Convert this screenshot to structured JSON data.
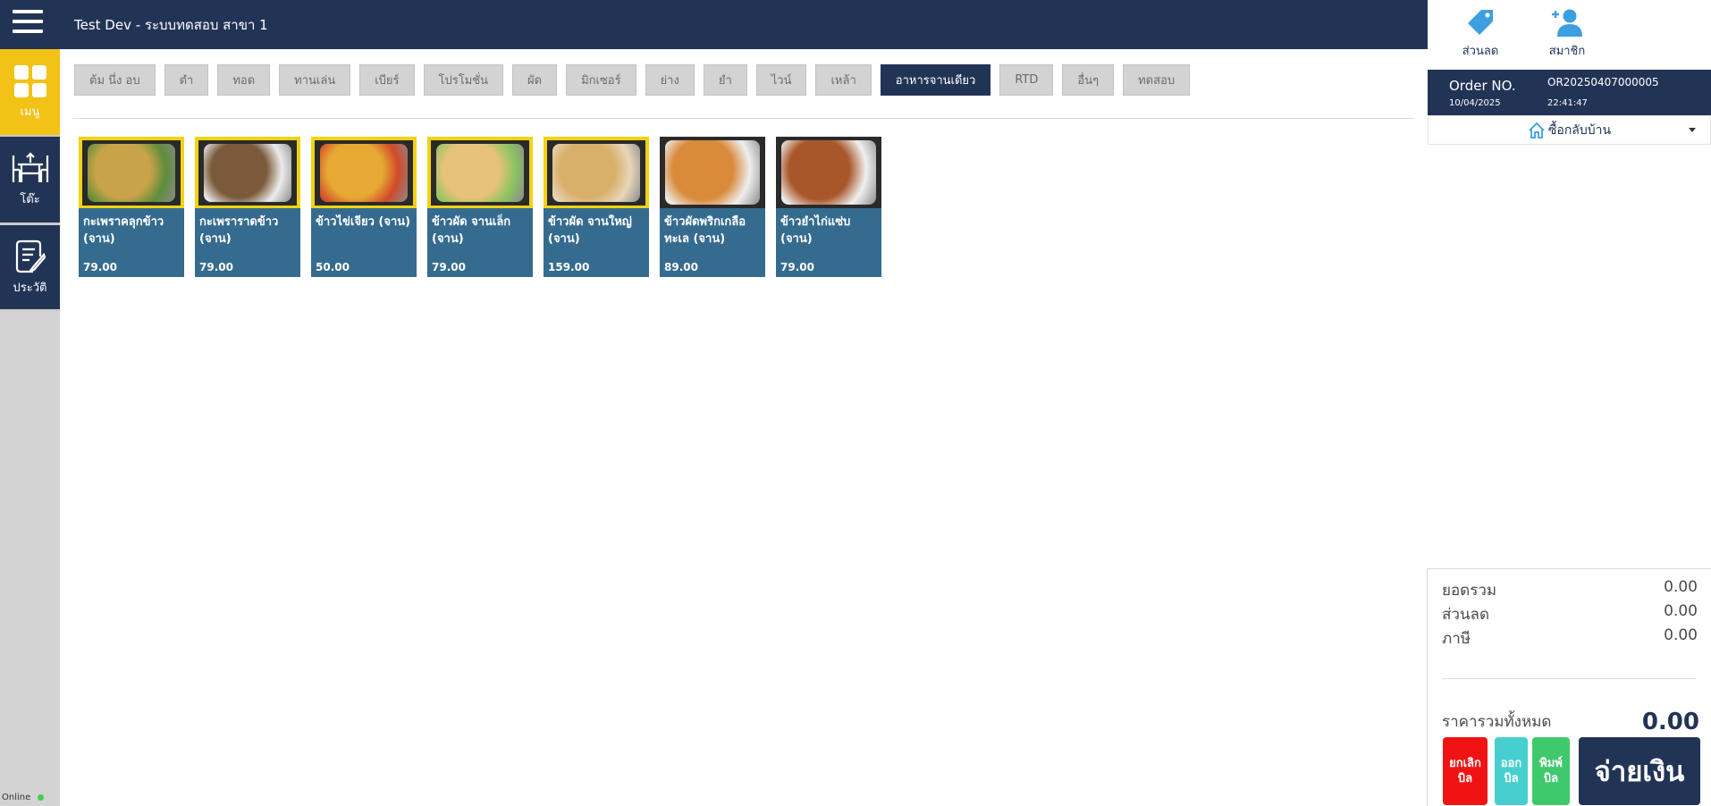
{
  "app": {
    "title": "Test Dev - ระบบทดสอบ สาขา 1"
  },
  "nav": {
    "items": [
      {
        "label": "เมนู",
        "icon": "grid-icon"
      },
      {
        "label": "โต๊ะ",
        "icon": "table-icon"
      },
      {
        "label": "ประวัติ",
        "icon": "history-icon"
      }
    ],
    "status": "Online"
  },
  "categories": [
    {
      "label": "ต้ม นึ่ง อบ",
      "active": false
    },
    {
      "label": "ตำ",
      "active": false
    },
    {
      "label": "ทอด",
      "active": false
    },
    {
      "label": "ทานเล่น",
      "active": false
    },
    {
      "label": "เบียร์",
      "active": false
    },
    {
      "label": "โปรโมชั่น",
      "active": false
    },
    {
      "label": "ผัด",
      "active": false
    },
    {
      "label": "มิกเซอร์",
      "active": false
    },
    {
      "label": "ย่าง",
      "active": false
    },
    {
      "label": "ยำ",
      "active": false
    },
    {
      "label": "ไวน์",
      "active": false
    },
    {
      "label": "เหล้า",
      "active": false
    },
    {
      "label": "อาหารจานเดียว",
      "active": true
    },
    {
      "label": "RTD",
      "active": false
    },
    {
      "label": "อื่นๆ",
      "active": false
    },
    {
      "label": "ทดสอบ",
      "active": false
    }
  ],
  "products": [
    {
      "name": "กะเพราคลุกข้าว (จาน)",
      "price": "79.00"
    },
    {
      "name": "กะเพราราดข้าว (จาน)",
      "price": "79.00"
    },
    {
      "name": "ข้าวไข่เจียว (จาน)",
      "price": "50.00"
    },
    {
      "name": "ข้าวผัด จานเล็ก (จาน)",
      "price": "79.00"
    },
    {
      "name": "ข้าวผัด จานใหญ่ (จาน)",
      "price": "159.00"
    },
    {
      "name": "ข้าวผัดพริกเกลือ ทะเล (จาน)",
      "price": "89.00"
    },
    {
      "name": "ข้าวยำไก่แซ่บ (จาน)",
      "price": "79.00"
    }
  ],
  "right_panel": {
    "discount_label": "ส่วนลด",
    "member_label": "สมาชิก",
    "order_label": "Order NO.",
    "order_no": "OR20250407000005",
    "order_date": "10/04/2025",
    "order_time": "22:41:47",
    "order_type": "ซื้อกลับบ้าน"
  },
  "summary": {
    "subtotal_label": "ยอดรวม",
    "subtotal": "0.00",
    "discount_label": "ส่วนลด",
    "discount": "0.00",
    "tax_label": "ภาษี",
    "tax": "0.00",
    "total_label": "ราคารวมทั้งหมด",
    "total": "0.00"
  },
  "actions": {
    "cancel_bill": "ยกเลิก บิล",
    "open_bill": "ออก บิล",
    "print_bill": "พิมพ์ บิล",
    "pay": "จ่ายเงิน"
  },
  "colors": {
    "navy": "#223456",
    "yellow": "#f2c216",
    "card": "#356b8e"
  }
}
